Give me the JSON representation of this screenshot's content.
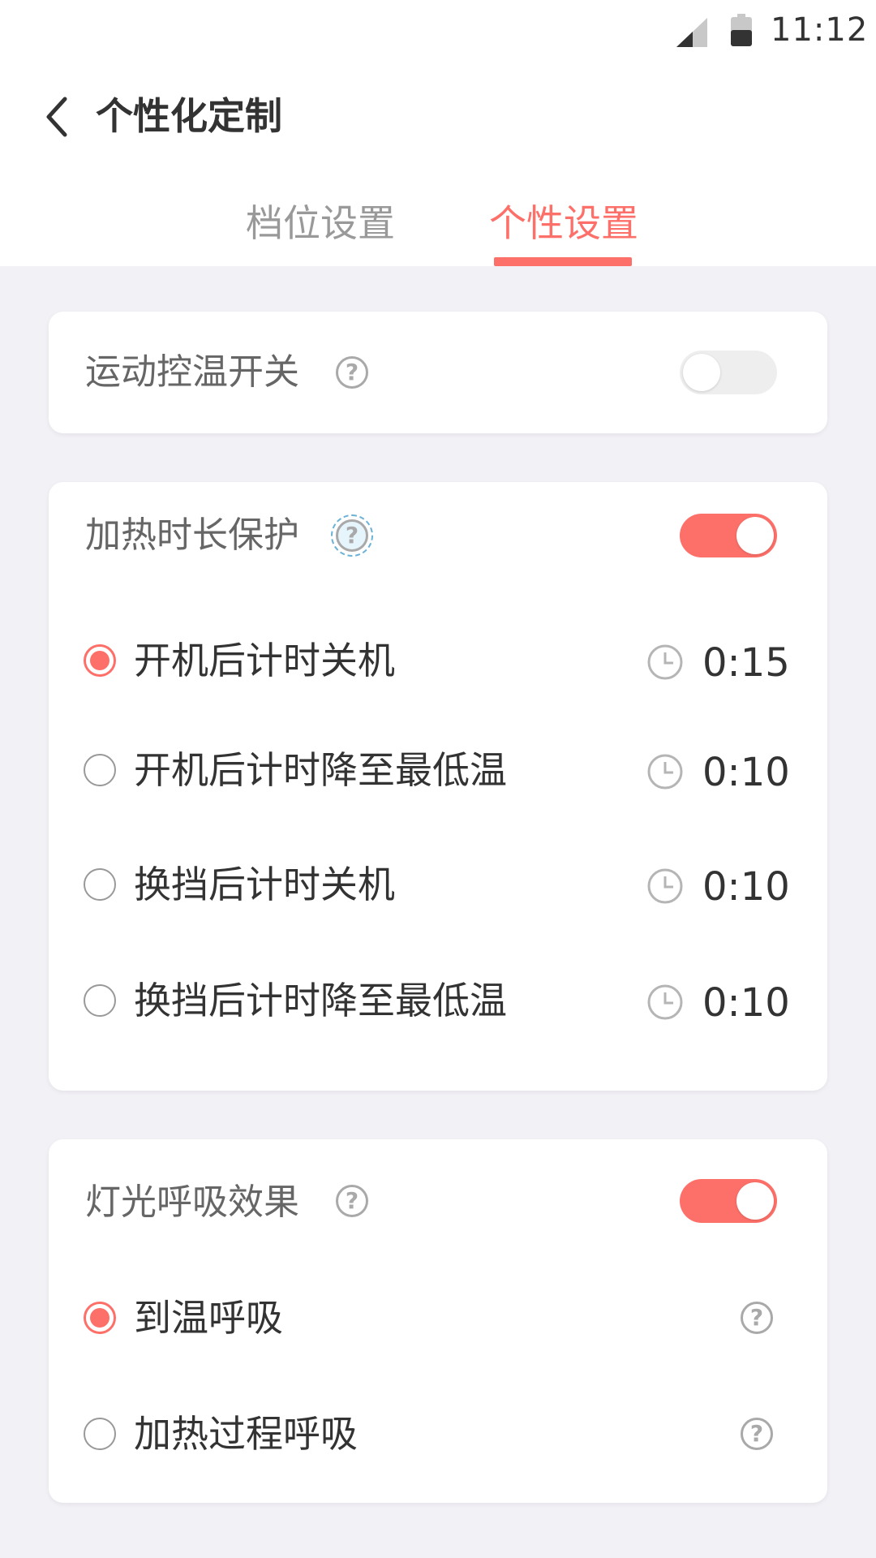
{
  "status_bar": {
    "time": "11:12",
    "signal_icon": "signal-icon",
    "battery_icon": "battery-icon"
  },
  "header": {
    "back_icon": "chevron-left-icon",
    "title": "个性化定制"
  },
  "tabs": [
    {
      "label": "档位设置",
      "active": false
    },
    {
      "label": "个性设置",
      "active": true
    }
  ],
  "accent_color": "#fd7069",
  "sport_temp": {
    "label": "运动控温开关",
    "enabled": false
  },
  "heating_protect": {
    "label": "加热时长保护",
    "enabled": true,
    "options": [
      {
        "label": "开机后计时关机",
        "time": "0:15",
        "selected": true
      },
      {
        "label": "开机后计时降至最低温",
        "time": "0:10",
        "selected": false
      },
      {
        "label": "换挡后计时关机",
        "time": "0:10",
        "selected": false
      },
      {
        "label": "换挡后计时降至最低温",
        "time": "0:10",
        "selected": false
      }
    ]
  },
  "light_breath": {
    "label": "灯光呼吸效果",
    "enabled": true,
    "options": [
      {
        "label": "到温呼吸",
        "selected": true
      },
      {
        "label": "加热过程呼吸",
        "selected": false
      }
    ]
  }
}
